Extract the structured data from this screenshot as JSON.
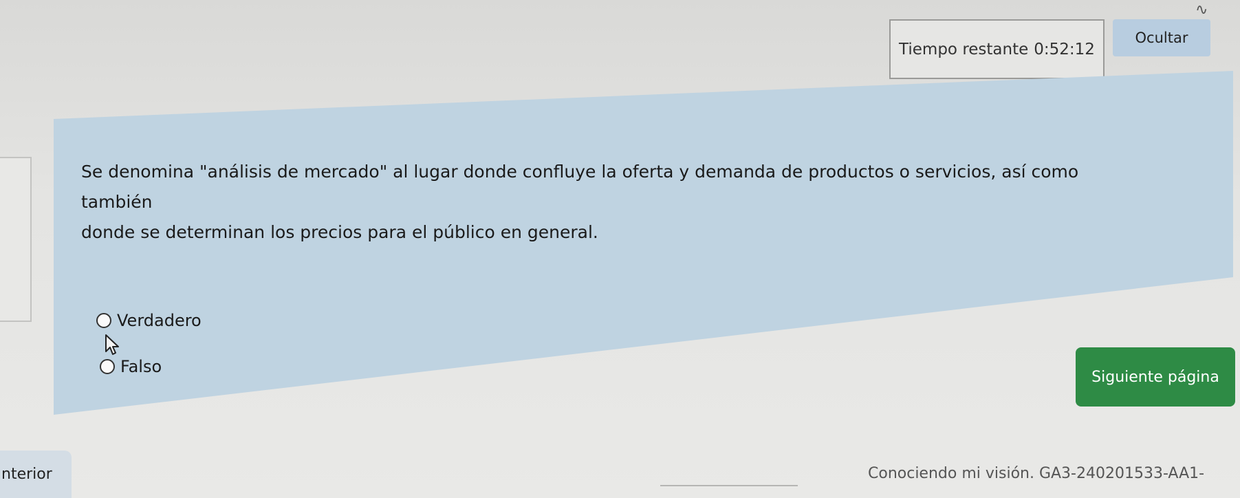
{
  "timer": {
    "label": "Tiempo restante",
    "value": "0:52:12"
  },
  "header": {
    "hide_label": "Ocultar"
  },
  "question": {
    "line1": "Se denomina \"análisis de mercado\" al lugar donde confluye la oferta y demanda de productos o servicios, así como también",
    "line2": "donde se determinan los precios para el público en general."
  },
  "options": [
    {
      "label": "Verdadero",
      "selected": false
    },
    {
      "label": "Falso",
      "selected": false
    }
  ],
  "navigation": {
    "next_label": "Siguiente página",
    "prev_label": "nterior"
  },
  "footer": {
    "activity_label": "Conociendo mi visión.  GA3-240201533-AA1-"
  },
  "colors": {
    "panel": "#bfd3e1",
    "next_button": "#2e8b45",
    "hide_button": "#b8cde0"
  }
}
